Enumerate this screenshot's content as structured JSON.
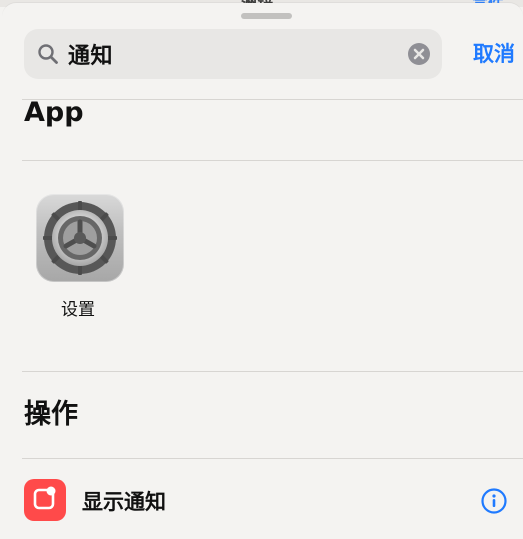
{
  "window": {
    "peek_title": "洲锌",
    "peek_action": "宣件"
  },
  "search": {
    "query": "通知",
    "cancel_label": "取消",
    "icons": {
      "search": "search-icon",
      "clear": "clear-icon"
    }
  },
  "sections": {
    "apps": {
      "title": "App",
      "items": [
        {
          "label": "设置",
          "icon": "settings-icon"
        }
      ]
    },
    "actions": {
      "title": "操作",
      "items": [
        {
          "label": "显示通知",
          "icon": "notification-icon",
          "trailing_icon": "info-icon"
        }
      ]
    }
  },
  "colors": {
    "background": "#f4f3f1",
    "search_field": "#e8e7e5",
    "accent": "#1f7aff",
    "notification_red": "#ff4a4a",
    "settings_gray": "#b5b5b5"
  }
}
